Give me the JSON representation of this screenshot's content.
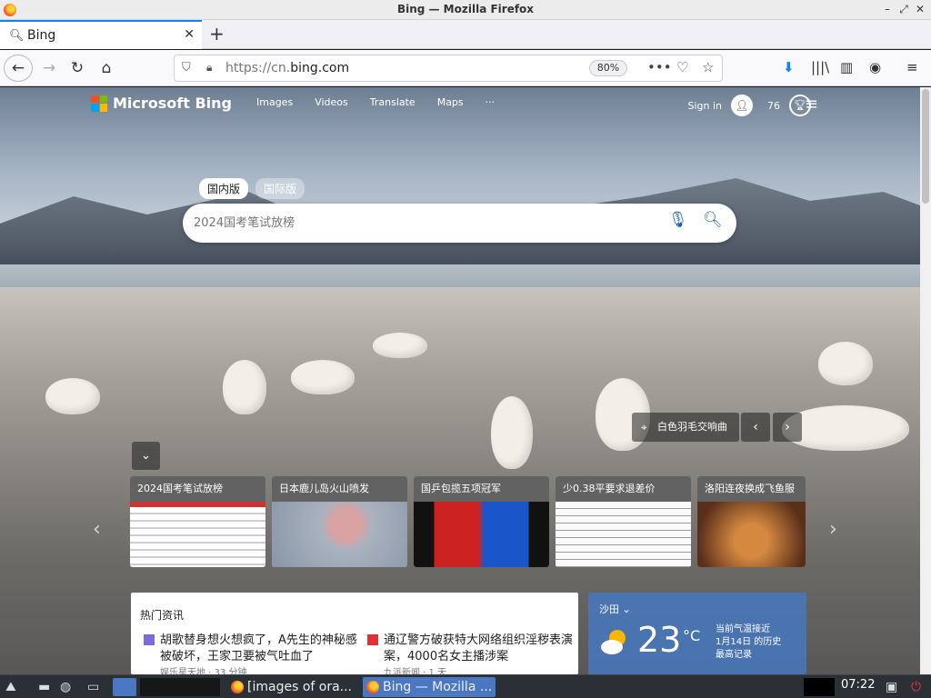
{
  "window": {
    "title": "Bing — Mozilla Firefox"
  },
  "tab": {
    "label": "Bing"
  },
  "navbar": {
    "url_prefix": "https://cn.",
    "url_domain": "bing.com",
    "zoom": "80%"
  },
  "bing": {
    "logo_text": "Microsoft Bing",
    "nav": [
      "Images",
      "Videos",
      "Translate",
      "Maps",
      "···"
    ],
    "signin": "Sign in",
    "points": "76",
    "scope": [
      "国内版",
      "国际版"
    ],
    "search_placeholder": "2024国考笔试放榜",
    "caption": "白色羽毛交响曲"
  },
  "cards": [
    {
      "title": "2024国考笔试放榜"
    },
    {
      "title": "日本鹿儿岛火山喷发"
    },
    {
      "title": "国乒包揽五项冠军"
    },
    {
      "title": "少0.38平要求退差价"
    },
    {
      "title": "洛阳连夜换成飞鱼服"
    }
  ],
  "hot_news": {
    "title": "热门资讯",
    "items": [
      {
        "text": "胡歌替身想火想疯了，A先生的神秘感被破坏，王家卫要被气吐血了",
        "sub": "娱乐星天地 · 33 分钟"
      },
      {
        "text": "通辽警方破获特大网络组织淫秽表演案，4000名女主播涉案",
        "sub": "九派新闻 · 1 天"
      }
    ]
  },
  "weather": {
    "city": "沙田",
    "temp": "23",
    "unit": "°C",
    "note_line1": "当前气温接近",
    "note_line2": "1月14日 的历史",
    "note_line3": "最高记录"
  },
  "taskbar": {
    "task1": "[images of ora...",
    "task2": "Bing — Mozilla ...",
    "clock": "07:22"
  }
}
